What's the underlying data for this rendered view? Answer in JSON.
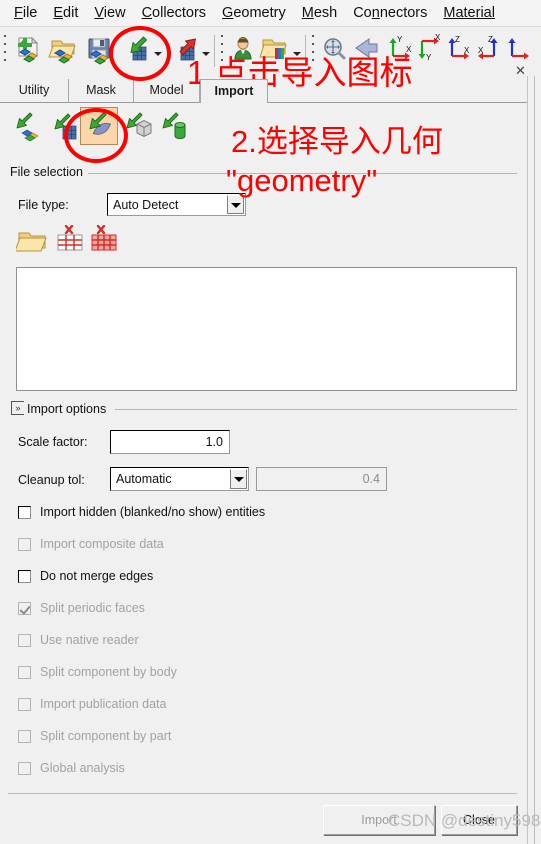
{
  "menubar": {
    "items": [
      {
        "name": "file",
        "mnemonic": "F",
        "rest": "ile"
      },
      {
        "name": "edit",
        "mnemonic": "E",
        "rest": "dit"
      },
      {
        "name": "view",
        "mnemonic": "V",
        "rest": "iew"
      },
      {
        "name": "collectors",
        "mnemonic": "C",
        "rest": "ollectors"
      },
      {
        "name": "geometry",
        "mnemonic": "G",
        "rest": "eometry"
      },
      {
        "name": "mesh",
        "mnemonic": "M",
        "rest": "esh"
      },
      {
        "name": "connectors",
        "pre": "Co",
        "mnemonic": "n",
        "rest": "nectors"
      },
      {
        "name": "materials",
        "mnemonic": "",
        "rest": "Material"
      }
    ]
  },
  "toolbar": {
    "buttons": [
      {
        "name": "new-model-button",
        "icon": "new-model-icon"
      },
      {
        "name": "open-model-button",
        "icon": "open-folder-icon"
      },
      {
        "name": "save-model-button",
        "icon": "save-disk-icon"
      },
      {
        "name": "import-button",
        "icon": "import-green-arrow-icon"
      },
      {
        "name": "export-button",
        "icon": "export-red-arrow-icon"
      },
      {
        "name": "user-profile-button",
        "icon": "user-profile-icon"
      },
      {
        "name": "load-userprofile-button",
        "icon": "folder-colors-icon"
      },
      {
        "name": "fit-view-button",
        "icon": "zoom-fit-icon"
      },
      {
        "name": "back-view-button",
        "icon": "back-arrow-icon"
      },
      {
        "name": "xy-view-button",
        "icon": "axis-xy-icon"
      },
      {
        "name": "xy-neg-view-button",
        "icon": "axis-xy-neg-icon"
      },
      {
        "name": "zx-view-button",
        "icon": "axis-zx-icon"
      },
      {
        "name": "zx-neg-view-button",
        "icon": "axis-zx-neg-icon"
      },
      {
        "name": "yz-view-button",
        "icon": "axis-yz-icon"
      }
    ]
  },
  "tabs": [
    {
      "label": "Utility",
      "active": false
    },
    {
      "label": "Mask",
      "active": false
    },
    {
      "label": "Model",
      "active": false
    },
    {
      "label": "Import",
      "active": true
    }
  ],
  "import_type_buttons": [
    {
      "name": "import-solver-deck-button",
      "icon": "import-solver-icon",
      "selected": false
    },
    {
      "name": "import-mesh-button",
      "icon": "import-mesh-icon",
      "selected": false
    },
    {
      "name": "import-geometry-button",
      "icon": "import-geometry-icon",
      "selected": true
    },
    {
      "name": "import-connectors-button",
      "icon": "import-cube-icon",
      "selected": false
    },
    {
      "name": "import-xy-data-button",
      "icon": "import-cylinder-icon",
      "selected": false
    }
  ],
  "file_selection": {
    "group_label": "File selection",
    "file_type_label": "File type:",
    "file_type_value": "Auto Detect",
    "file_type_options": [
      "Auto Detect"
    ],
    "actions": [
      {
        "name": "browse-file-button",
        "icon": "open-folder-icon"
      },
      {
        "name": "remove-selected-file-button",
        "icon": "table-delete-icon"
      },
      {
        "name": "remove-all-files-button",
        "icon": "table-delete-all-icon"
      }
    ],
    "file_list": []
  },
  "import_options": {
    "group_label": "Import options",
    "expander_glyph": "»",
    "scale_factor_label": "Scale factor:",
    "scale_factor_value": "1.0",
    "cleanup_tol_label": "Cleanup tol:",
    "cleanup_tol_value": "Automatic",
    "cleanup_tol_options": [
      "Automatic"
    ],
    "cleanup_tol_number": "0.4",
    "checkboxes": [
      {
        "label": "Import hidden (blanked/no show) entities",
        "checked": false,
        "enabled": true
      },
      {
        "label": "Import composite data",
        "checked": false,
        "enabled": false
      },
      {
        "label": "Do not merge edges",
        "checked": false,
        "enabled": true
      },
      {
        "label": "Split periodic faces",
        "checked": true,
        "enabled": false
      },
      {
        "label": "Use native reader",
        "checked": false,
        "enabled": false
      },
      {
        "label": "Split component by body",
        "checked": false,
        "enabled": false
      },
      {
        "label": "Import publication data",
        "checked": false,
        "enabled": false
      },
      {
        "label": "Split component by part",
        "checked": false,
        "enabled": false
      },
      {
        "label": "Global analysis",
        "checked": false,
        "enabled": false
      }
    ]
  },
  "footer": {
    "import_button": "Import",
    "import_enabled": false,
    "close_button": "Close"
  },
  "panel_close_glyph": "✕",
  "annotations": [
    {
      "name": "annotation-step-1",
      "text": "1.点击导入图标"
    },
    {
      "name": "annotation-step-2-line1",
      "text": "2.选择导入几何"
    },
    {
      "name": "annotation-step-2-line2",
      "text": "\"geometry\""
    }
  ],
  "watermark": "CSDN @destiny598",
  "colors": {
    "annotation_red": "#ff0000",
    "panel_bg": "#f0f0f0",
    "selection_orange": "#fcd5a8",
    "field_white": "#ffffff",
    "disabled_text": "#a0a0a0"
  }
}
